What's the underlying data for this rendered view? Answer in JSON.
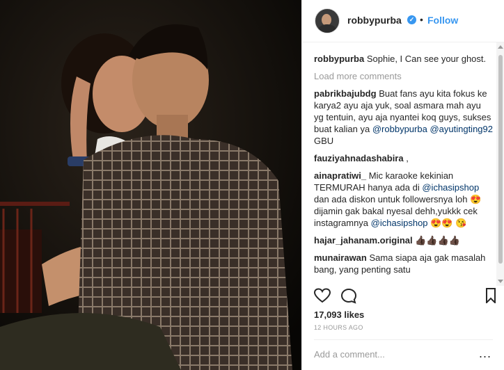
{
  "header": {
    "username": "robbypurba",
    "verified_symbol": "✓",
    "separator": "•",
    "follow_label": "Follow"
  },
  "comments": {
    "caption": {
      "user": "robbypurba",
      "text": "Sophie, I Can see your ghost."
    },
    "load_more_label": "Load more comments",
    "items": [
      {
        "user": "pabrikbajubdg",
        "text": "Buat fans ayu kita fokus ke karya2 ayu aja yuk, soal asmara mah ayu yg tentuin, ayu aja nyantei koq guys, sukses buat kalian ya",
        "mention1": "@robbypurba",
        "mention2": "@ayutingting92",
        "tail": "GBU"
      },
      {
        "user": "fauziyahnadashabira",
        "text": ","
      },
      {
        "user": "ainapratiwi_",
        "text": "Mic karaoke kekinian TERMURAH hanya ada di",
        "mention1": "@ichasipshop",
        "text2": "dan ada diskon untuk followersnya loh 😍 dijamin gak bakal nyesal dehh,yukkk cek instagramnya",
        "mention2": "@ichasipshop",
        "tail": "😍😍 😘"
      },
      {
        "user": "hajar_jahanam.original",
        "text": "👍🏿👍🏿👍🏿👍🏿"
      },
      {
        "user": "munairawan",
        "text": "Sama siapa aja gak masalah bang, yang penting satu"
      }
    ]
  },
  "actions": {
    "like_icon": "heart-icon",
    "comment_icon": "comment-icon",
    "save_icon": "bookmark-icon"
  },
  "likes_text": "17,093 likes",
  "timestamp": "12 HOURS AGO",
  "add_comment_placeholder": "Add a comment...",
  "more_label": "...",
  "colors": {
    "accent": "#3897f0",
    "mention": "#003569",
    "muted": "#999999",
    "text": "#262626"
  }
}
